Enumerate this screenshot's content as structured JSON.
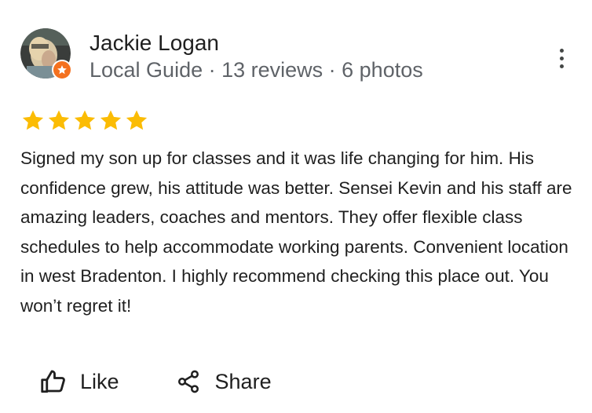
{
  "reviewer": {
    "name": "Jackie Logan",
    "meta": "Local Guide · 13 reviews · 6 photos",
    "badge_icon": "local-guide-star-icon",
    "badge_color": "#f4711f"
  },
  "menu": {
    "icon": "more-vert-icon"
  },
  "rating": {
    "value": 5,
    "max": 5,
    "star_color": "#fbbc04"
  },
  "review": {
    "text": "Signed my son up for classes and it was life changing for him. His confidence grew, his attitude was better. Sensei Kevin and his staff are amazing leaders, coaches and mentors. They offer flexible class schedules to help accommodate working parents. Convenient location in west Bradenton. I highly recommend checking this place out. You won’t regret it!"
  },
  "actions": {
    "like_label": "Like",
    "like_icon": "thumbs-up-icon",
    "share_label": "Share",
    "share_icon": "share-icon"
  }
}
